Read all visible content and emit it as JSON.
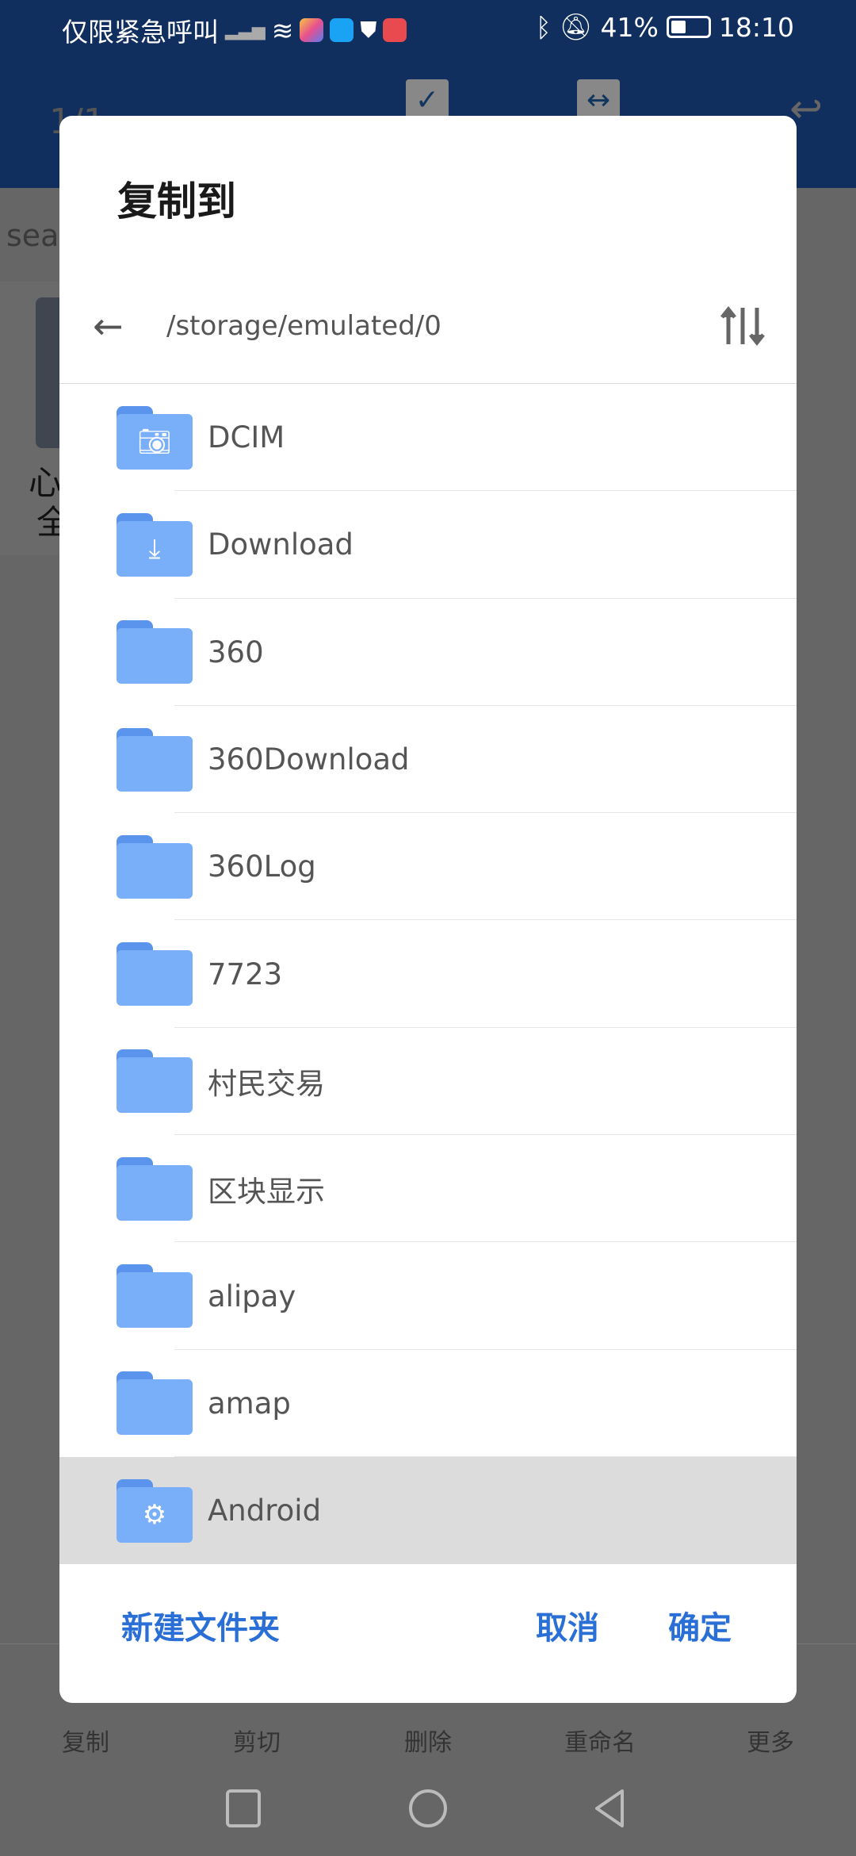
{
  "status_bar": {
    "carrier": "仅限紧急呼叫",
    "battery": "41%",
    "time": "18:10",
    "icons": [
      "signal-x-icon",
      "wifi-icon",
      "app-icon-colorful",
      "search-app-icon",
      "shield-icon",
      "book-app-icon",
      "bluetooth-icon",
      "bell-muted-icon",
      "battery-icon"
    ]
  },
  "background": {
    "page_count": "1/1",
    "search_text": "sear",
    "card_text_1": "心",
    "card_text_2": "全",
    "toolbar": [
      "复制",
      "剪切",
      "删除",
      "重命名",
      "更多"
    ]
  },
  "dialog": {
    "title": "复制到",
    "path": "/storage/emulated/0",
    "folders": [
      {
        "name": "DCIM",
        "icon": "camera-icon"
      },
      {
        "name": "Download",
        "icon": "download-icon"
      },
      {
        "name": "360",
        "icon": ""
      },
      {
        "name": "360Download",
        "icon": ""
      },
      {
        "name": "360Log",
        "icon": ""
      },
      {
        "name": "7723",
        "icon": ""
      },
      {
        "name": "村民交易",
        "icon": ""
      },
      {
        "name": "区块显示",
        "icon": ""
      },
      {
        "name": "alipay",
        "icon": ""
      },
      {
        "name": "amap",
        "icon": ""
      },
      {
        "name": "Android",
        "icon": "gear-icon",
        "selected": true
      }
    ],
    "new_folder": "新建文件夹",
    "cancel": "取消",
    "confirm": "确定"
  },
  "colors": {
    "header": "#102e5e",
    "accent": "#2a6fd6",
    "folder": "#79aef8",
    "selected_row": "#dcdcdc"
  }
}
